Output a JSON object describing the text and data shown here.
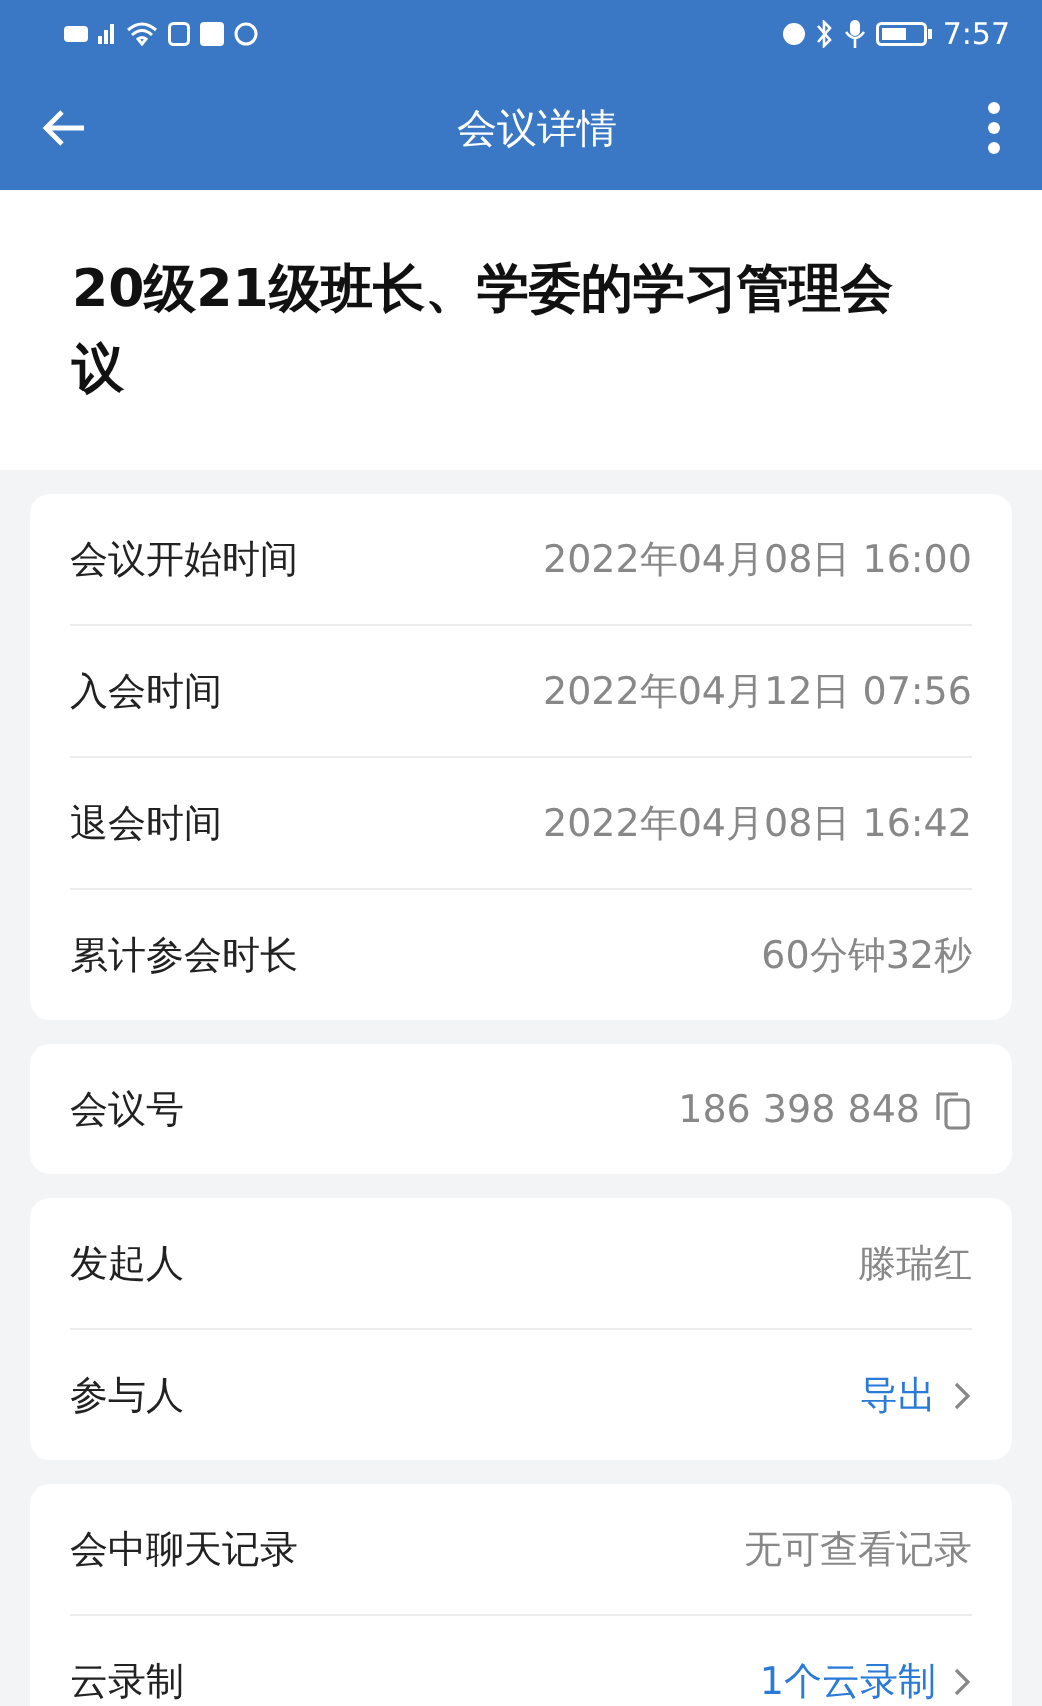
{
  "status_bar": {
    "time": "7:57"
  },
  "app_bar": {
    "title": "会议详情"
  },
  "meeting_title": "20级21级班长、学委的学习管理会议",
  "groups": [
    {
      "rows": [
        {
          "label": "会议开始时间",
          "value": "2022年04月08日 16:00",
          "kind": "plain"
        },
        {
          "label": "入会时间",
          "value": "2022年04月12日 07:56",
          "kind": "plain"
        },
        {
          "label": "退会时间",
          "value": "2022年04月08日 16:42",
          "kind": "plain"
        },
        {
          "label": "累计参会时长",
          "value": "60分钟32秒",
          "kind": "plain"
        }
      ]
    },
    {
      "rows": [
        {
          "label": "会议号",
          "value": "186 398 848",
          "kind": "copy"
        }
      ]
    },
    {
      "rows": [
        {
          "label": "发起人",
          "value": "滕瑞红",
          "kind": "plain"
        },
        {
          "label": "参与人",
          "value": "导出",
          "kind": "link"
        }
      ]
    },
    {
      "rows": [
        {
          "label": "会中聊天记录",
          "value": "无可查看记录",
          "kind": "plain"
        },
        {
          "label": "云录制",
          "value": "1个云录制",
          "kind": "link"
        }
      ]
    }
  ]
}
